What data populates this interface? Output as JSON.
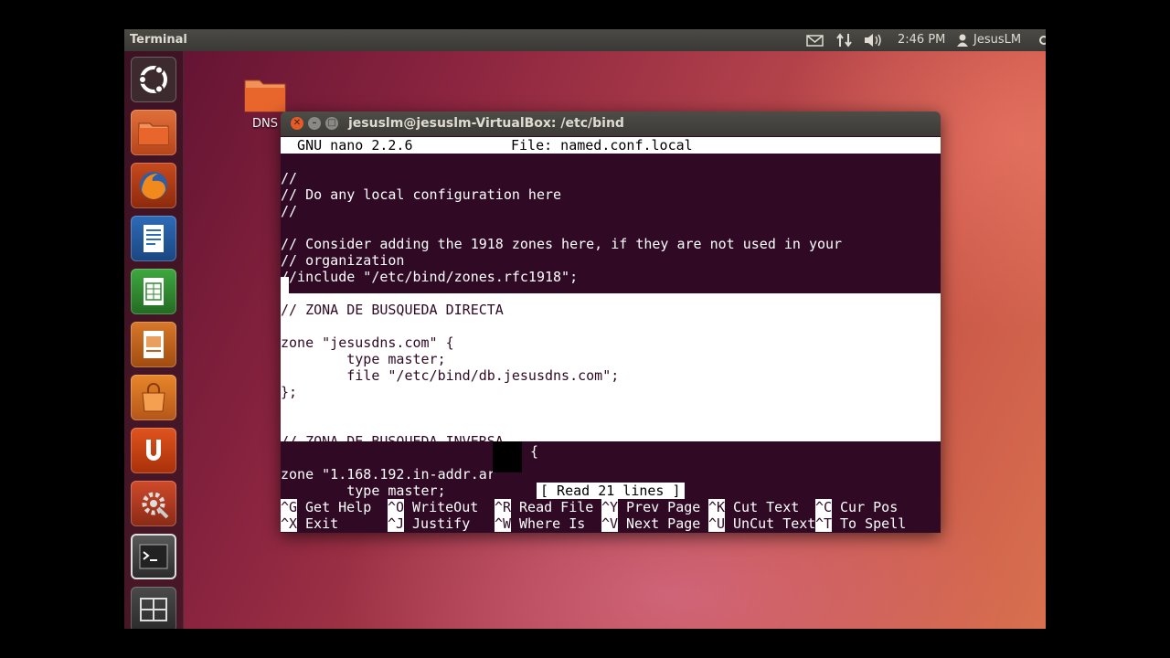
{
  "topbar": {
    "app_title": "Terminal",
    "icons": [
      "mail-icon",
      "network-icon",
      "volume-icon"
    ],
    "time": "2:46 PM",
    "user": "JesusLM"
  },
  "launcher": {
    "items": [
      "dash-home",
      "files",
      "firefox",
      "libreoffice-writer",
      "libreoffice-calc",
      "libreoffice-impress",
      "ubuntu-software-center",
      "ubuntu-one",
      "system-settings",
      "terminal",
      "workspace-switcher"
    ]
  },
  "desktop": {
    "icon_label": "DNS"
  },
  "window": {
    "title": "jesuslm@jesuslm-VirtualBox: /etc/bind"
  },
  "nano": {
    "header_version": "  GNU nano 2.2.6",
    "header_file": "File: named.conf.local",
    "lines": [
      "",
      "//",
      "// Do any local configuration here",
      "//",
      "",
      "// Consider adding the 1918 zones here, if they are not used in your",
      "// organization",
      "//include \"/etc/bind/zones.rfc1918\";",
      "",
      "// ZONA DE BUSQUEDA DIRECTA",
      "",
      "zone \"jesusdns.com\" {",
      "        type master;",
      "        file \"/etc/bind/db.jesusdns.com\";",
      "};",
      "",
      "",
      "// ZONA DE BUSQUEDA INVERSA",
      "",
      "zone \"1.168.192.in-addr.ar",
      "        type master;"
    ],
    "line_19_tail": " {",
    "status": "[ Read 21 lines ]",
    "shortcuts_row1": [
      {
        "key": "^G",
        "label": " Get Help"
      },
      {
        "key": "^O",
        "label": " WriteOut"
      },
      {
        "key": "^R",
        "label": " Read File"
      },
      {
        "key": "^Y",
        "label": " Prev Page"
      },
      {
        "key": "^K",
        "label": " Cut Text"
      },
      {
        "key": "^C",
        "label": " Cur Pos"
      }
    ],
    "shortcuts_row2": [
      {
        "key": "^X",
        "label": " Exit"
      },
      {
        "key": "^J",
        "label": " Justify"
      },
      {
        "key": "^W",
        "label": " Where Is"
      },
      {
        "key": "^V",
        "label": " Next Page"
      },
      {
        "key": "^U",
        "label": " UnCut Text"
      },
      {
        "key": "^T",
        "label": " To Spell"
      }
    ]
  },
  "colors": {
    "terminal_bg": "#300a24",
    "close_button": "#e35b26",
    "panel_bg": "#3c3b37"
  }
}
